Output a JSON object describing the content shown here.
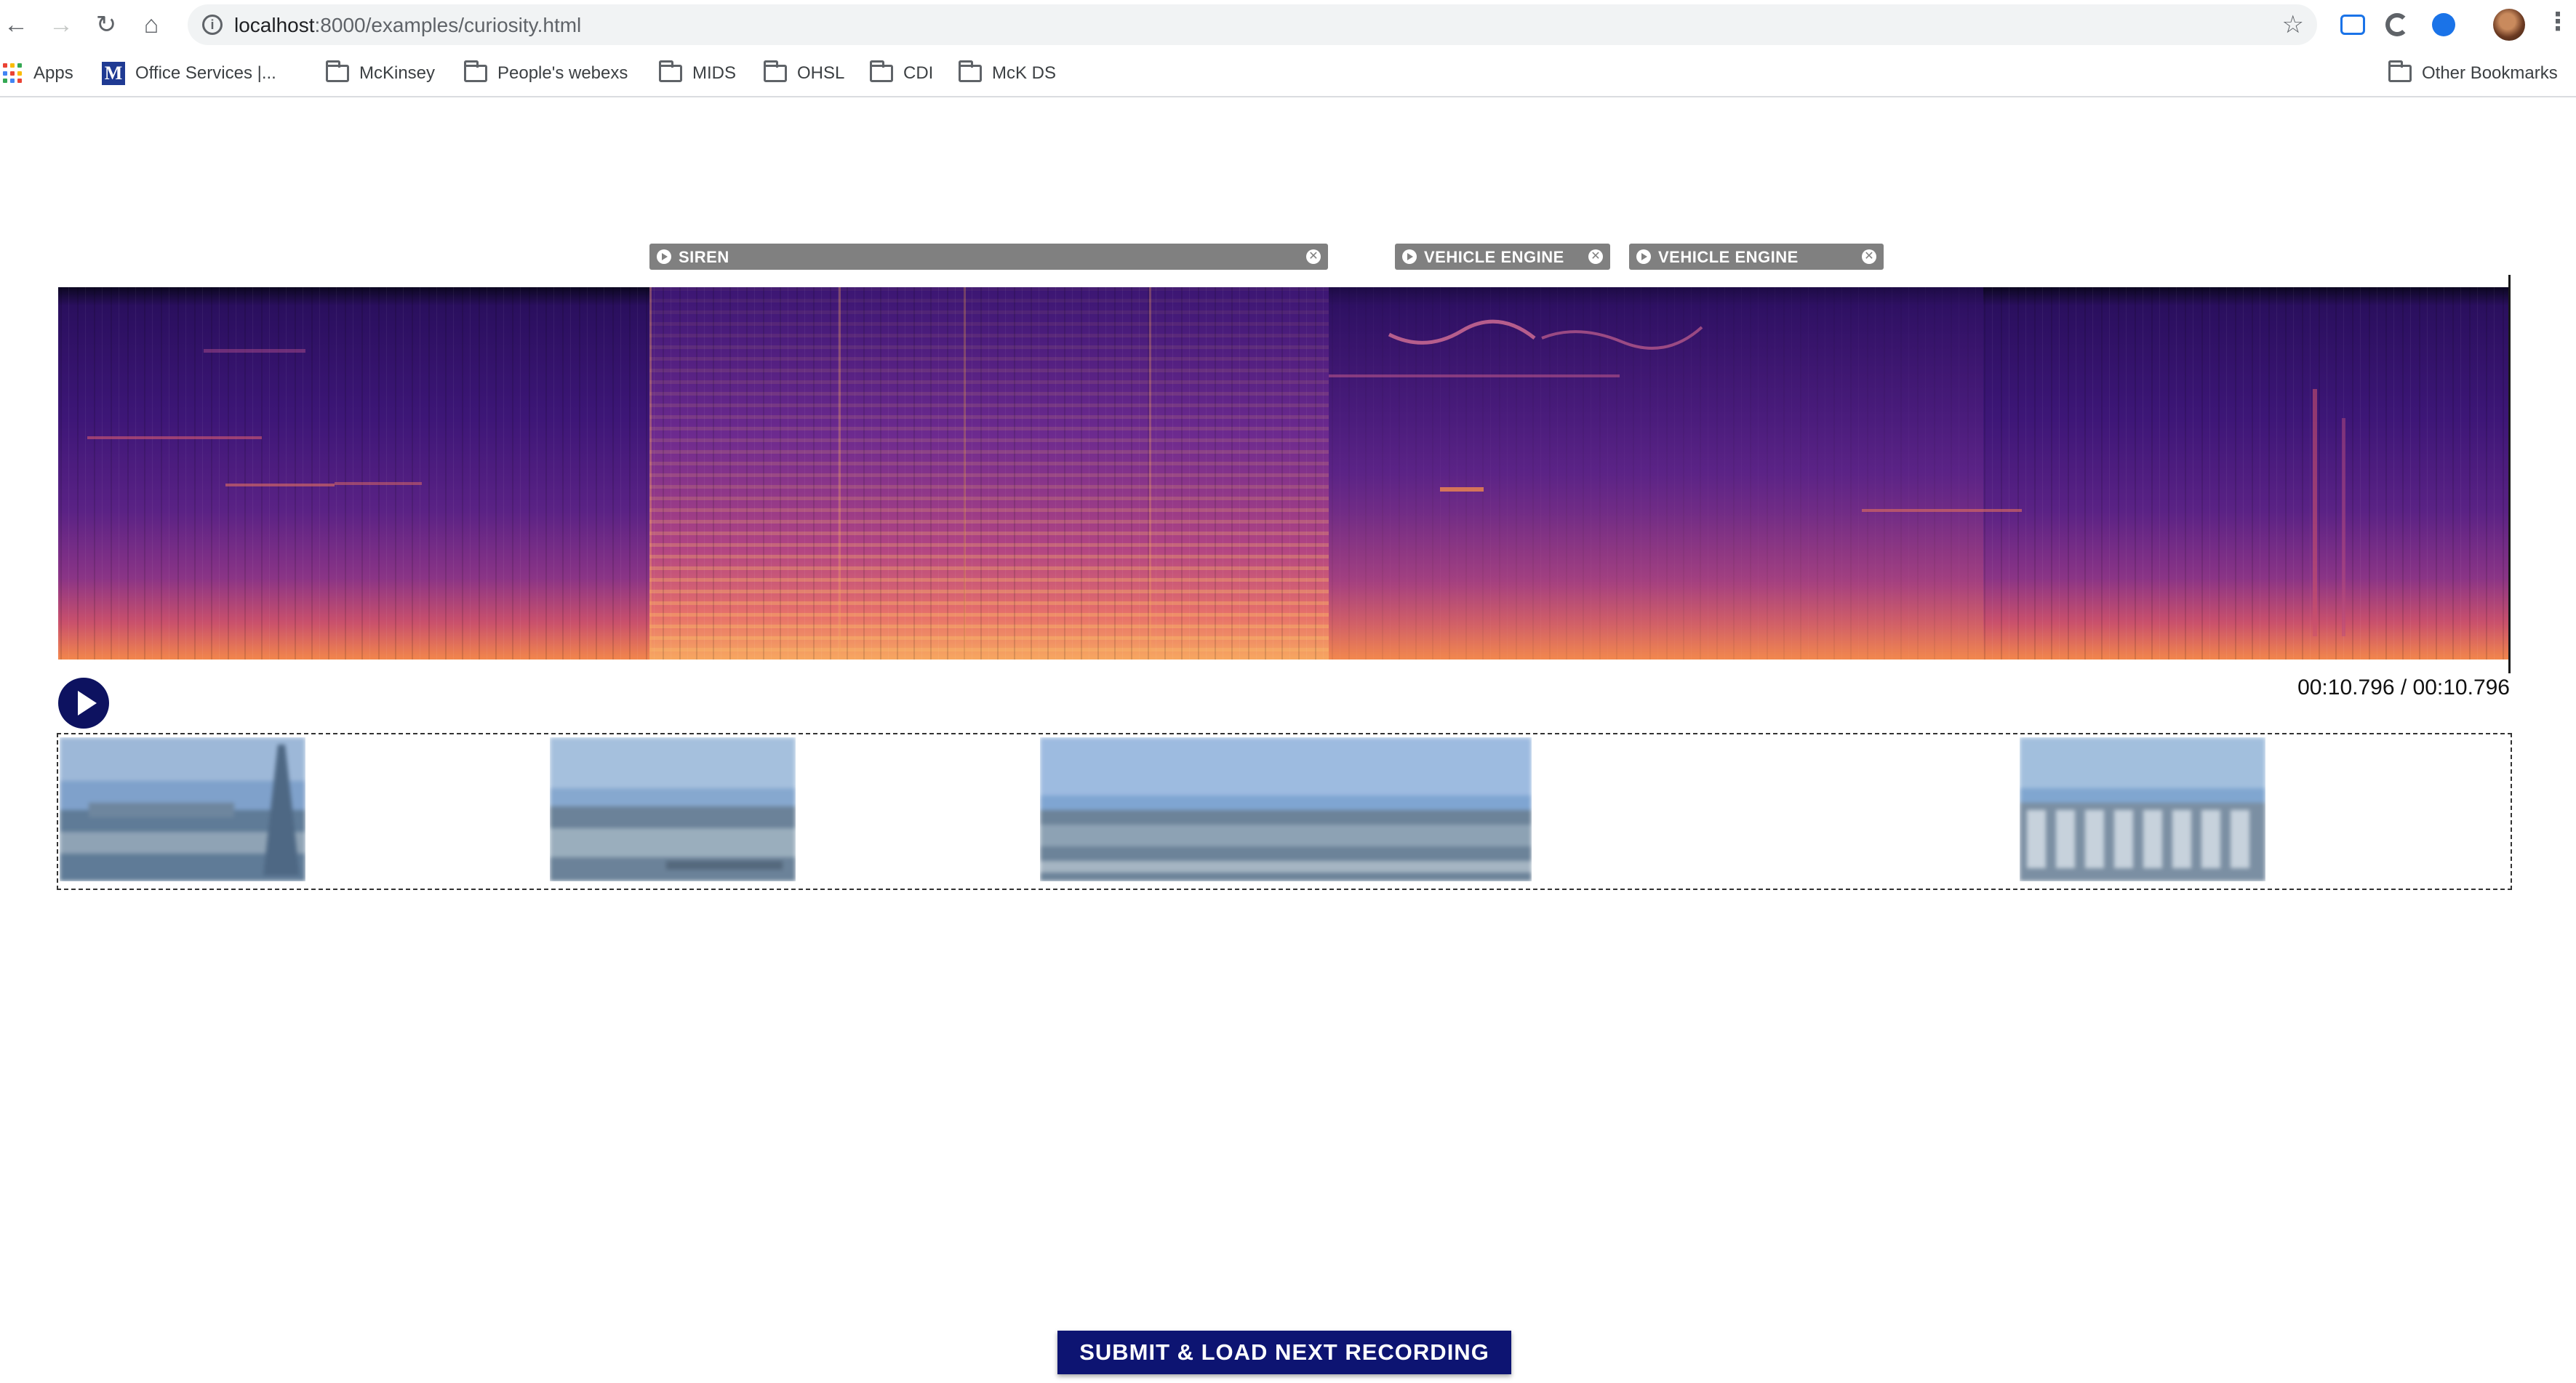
{
  "browser": {
    "url_host": "localhost",
    "url_path": ":8000/examples/curiosity.html",
    "bookmarks": [
      {
        "label": "Apps",
        "icon": "apps-grid-icon"
      },
      {
        "label": "Office Services |...",
        "icon": "mckinsey-logo-icon"
      },
      {
        "label": "McKinsey",
        "icon": "folder-icon"
      },
      {
        "label": "People's webexs",
        "icon": "folder-icon"
      },
      {
        "label": "MIDS",
        "icon": "folder-icon"
      },
      {
        "label": "OHSL",
        "icon": "folder-icon"
      },
      {
        "label": "CDI",
        "icon": "folder-icon"
      },
      {
        "label": "McK DS",
        "icon": "folder-icon"
      }
    ],
    "other_bookmarks": "Other Bookmarks"
  },
  "annotations": {
    "tags": [
      {
        "label": "SIREN"
      },
      {
        "label": "VEHICLE ENGINE"
      },
      {
        "label": "VEHICLE ENGINE"
      }
    ]
  },
  "player": {
    "time": "00:10.796 / 00:10.796"
  },
  "frames": {
    "count": 4
  },
  "actions": {
    "submit_label": "SUBMIT & LOAD NEXT RECORDING"
  },
  "colors": {
    "accent": "#0d1472",
    "tag_bg": "#808080",
    "spectro_low": "#1a0b4a",
    "spectro_mid": "#6b2c8f",
    "spectro_high": "#f28a4a"
  }
}
